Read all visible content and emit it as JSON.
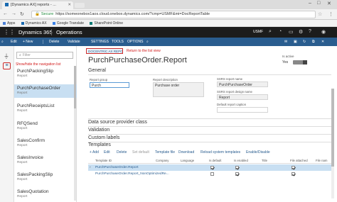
{
  "browser": {
    "tab_title": "[Dynamics AX] reports - ...",
    "secure_label": "Secure",
    "url": "https://someonebox1aos.cloud.onebox.dynamics.com/?cmp=USMF&mi=DocReportTable",
    "bookmarks": [
      "Apps",
      "Dynamics AX",
      "Google Translate",
      "SharePoint Online"
    ]
  },
  "header": {
    "brand": "Dynamics 365",
    "module": "Operations",
    "company": "USMF"
  },
  "actions": [
    "Edit",
    "+ New",
    "Delete",
    "Validate",
    "SETTINGS",
    "TOOLS",
    "OPTIONS"
  ],
  "annotations": {
    "show_hide": "Show/hide the navigation list",
    "return": "Return to the list view"
  },
  "navlist": {
    "filter_placeholder": "Filter",
    "items": [
      {
        "name": "PurchPackingSlip",
        "type": "Report"
      },
      {
        "name": "PurchPurchaseOrder",
        "type": "Report"
      },
      {
        "name": "PurchReceiptsList",
        "type": "Report"
      },
      {
        "name": "RFQSend",
        "type": "Report"
      },
      {
        "name": "SalesConfirm",
        "type": "Report"
      },
      {
        "name": "SalesInvoice",
        "type": "Report"
      },
      {
        "name": "SalesPackingSlip",
        "type": "Report"
      },
      {
        "name": "SalesQuotation",
        "type": "Report"
      }
    ]
  },
  "main": {
    "breadcrumb": "DOCENTRIC AX REPORTS",
    "title": "PurchPurchaseOrder.Report",
    "is_active_label": "Is active",
    "is_active_value": "Yes",
    "sections": {
      "general": "General",
      "data_source": "Data source provider class",
      "validation": "Validation",
      "custom_labels": "Custom labels",
      "templates": "Templates"
    },
    "fields": {
      "report_group_label": "Report group",
      "report_group_value": "Purch",
      "report_desc_label": "Report description",
      "report_desc_value": "Purchase order",
      "ssrs_name_label": "SSRS report name",
      "ssrs_name_value": "PurchPurchaseOrder",
      "ssrs_design_label": "SSRS report design name",
      "ssrs_design_value": "Report",
      "default_caption_label": "Default report caption",
      "default_caption_value": ""
    },
    "templates_toolbar": [
      "+ Add",
      "Edit",
      "Delete",
      "Set default",
      "Template file",
      "Download",
      "Reload system templates",
      "Enable/Disable"
    ],
    "grid_headers": [
      "Template ID",
      "Company",
      "Language",
      "Is default",
      "Is enabled",
      "Title",
      "File attached",
      "File nam"
    ],
    "grid_rows": [
      {
        "id": "PurchPurchaseOrder.Report",
        "is_default": true,
        "is_enabled": true,
        "file_attached": true,
        "selected": true
      },
      {
        "id": "PurchPurchaseOrder.Report_NonOptimizedRe...",
        "is_default": false,
        "is_enabled": true,
        "file_attached": true,
        "selected": false
      }
    ]
  },
  "colors": {
    "header_bg": "#1c1c1c",
    "action_pane": "#2a5d8f",
    "selected_row": "#c8dff2",
    "annotation": "#d32020"
  }
}
